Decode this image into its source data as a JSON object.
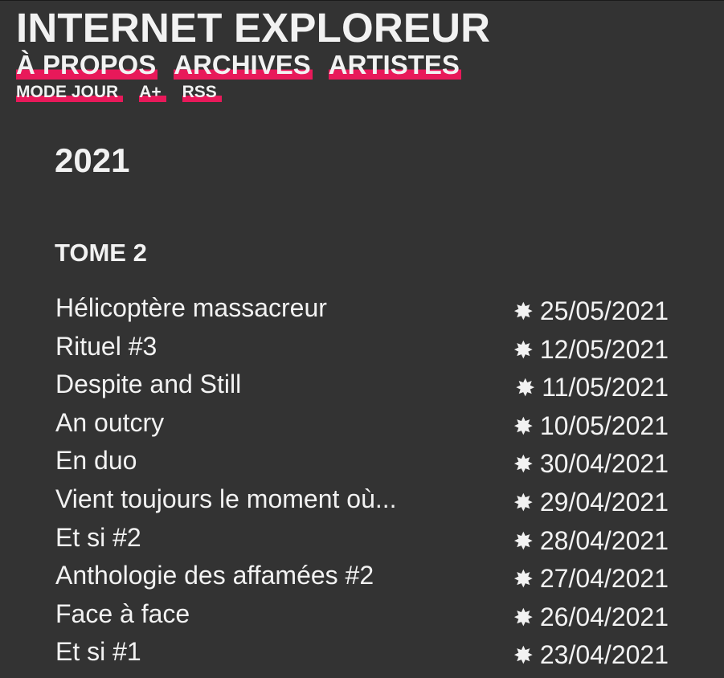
{
  "site": {
    "title": "INTERNET EXPLOREUR"
  },
  "nav": {
    "main": [
      {
        "label": "À PROPOS"
      },
      {
        "label": "ARCHIVES"
      },
      {
        "label": "ARTISTES"
      }
    ],
    "secondary": [
      {
        "label": "MODE JOUR"
      },
      {
        "label": "A+"
      },
      {
        "label": "RSS"
      }
    ]
  },
  "archive": {
    "year": "2021",
    "tome": "TOME 2",
    "date_icon": "star-burst-icon",
    "posts": [
      {
        "title": "Hélicoptère massacreur",
        "date": "25/05/2021"
      },
      {
        "title": "Rituel #3",
        "date": "12/05/2021"
      },
      {
        "title": "Despite and Still",
        "date": "11/05/2021"
      },
      {
        "title": "An outcry",
        "date": "10/05/2021"
      },
      {
        "title": "En duo",
        "date": "30/04/2021"
      },
      {
        "title": "Vient toujours le moment où...",
        "date": "29/04/2021"
      },
      {
        "title": "Et si #2",
        "date": "28/04/2021"
      },
      {
        "title": "Anthologie des affamées #2",
        "date": "27/04/2021"
      },
      {
        "title": "Face à face",
        "date": "26/04/2021"
      },
      {
        "title": "Et si #1",
        "date": "23/04/2021"
      }
    ]
  },
  "colors": {
    "background": "#333333",
    "text": "#f2f2f2",
    "accent": "#e8195a"
  }
}
